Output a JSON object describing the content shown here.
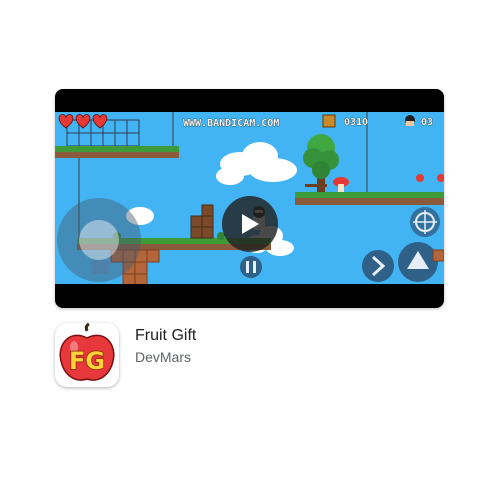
{
  "video": {
    "watermark": "WWW.BANDICAM.COM",
    "score": "0310",
    "lives": "03",
    "hearts": 3,
    "play_icon": "play-icon"
  },
  "app": {
    "title": "Fruit Gift",
    "developer": "DevMars",
    "icon_letters": "FG"
  },
  "colors": {
    "sky": "#42b4f4",
    "icon_red": "#e8383b",
    "icon_yellow": "#ffd23a"
  }
}
